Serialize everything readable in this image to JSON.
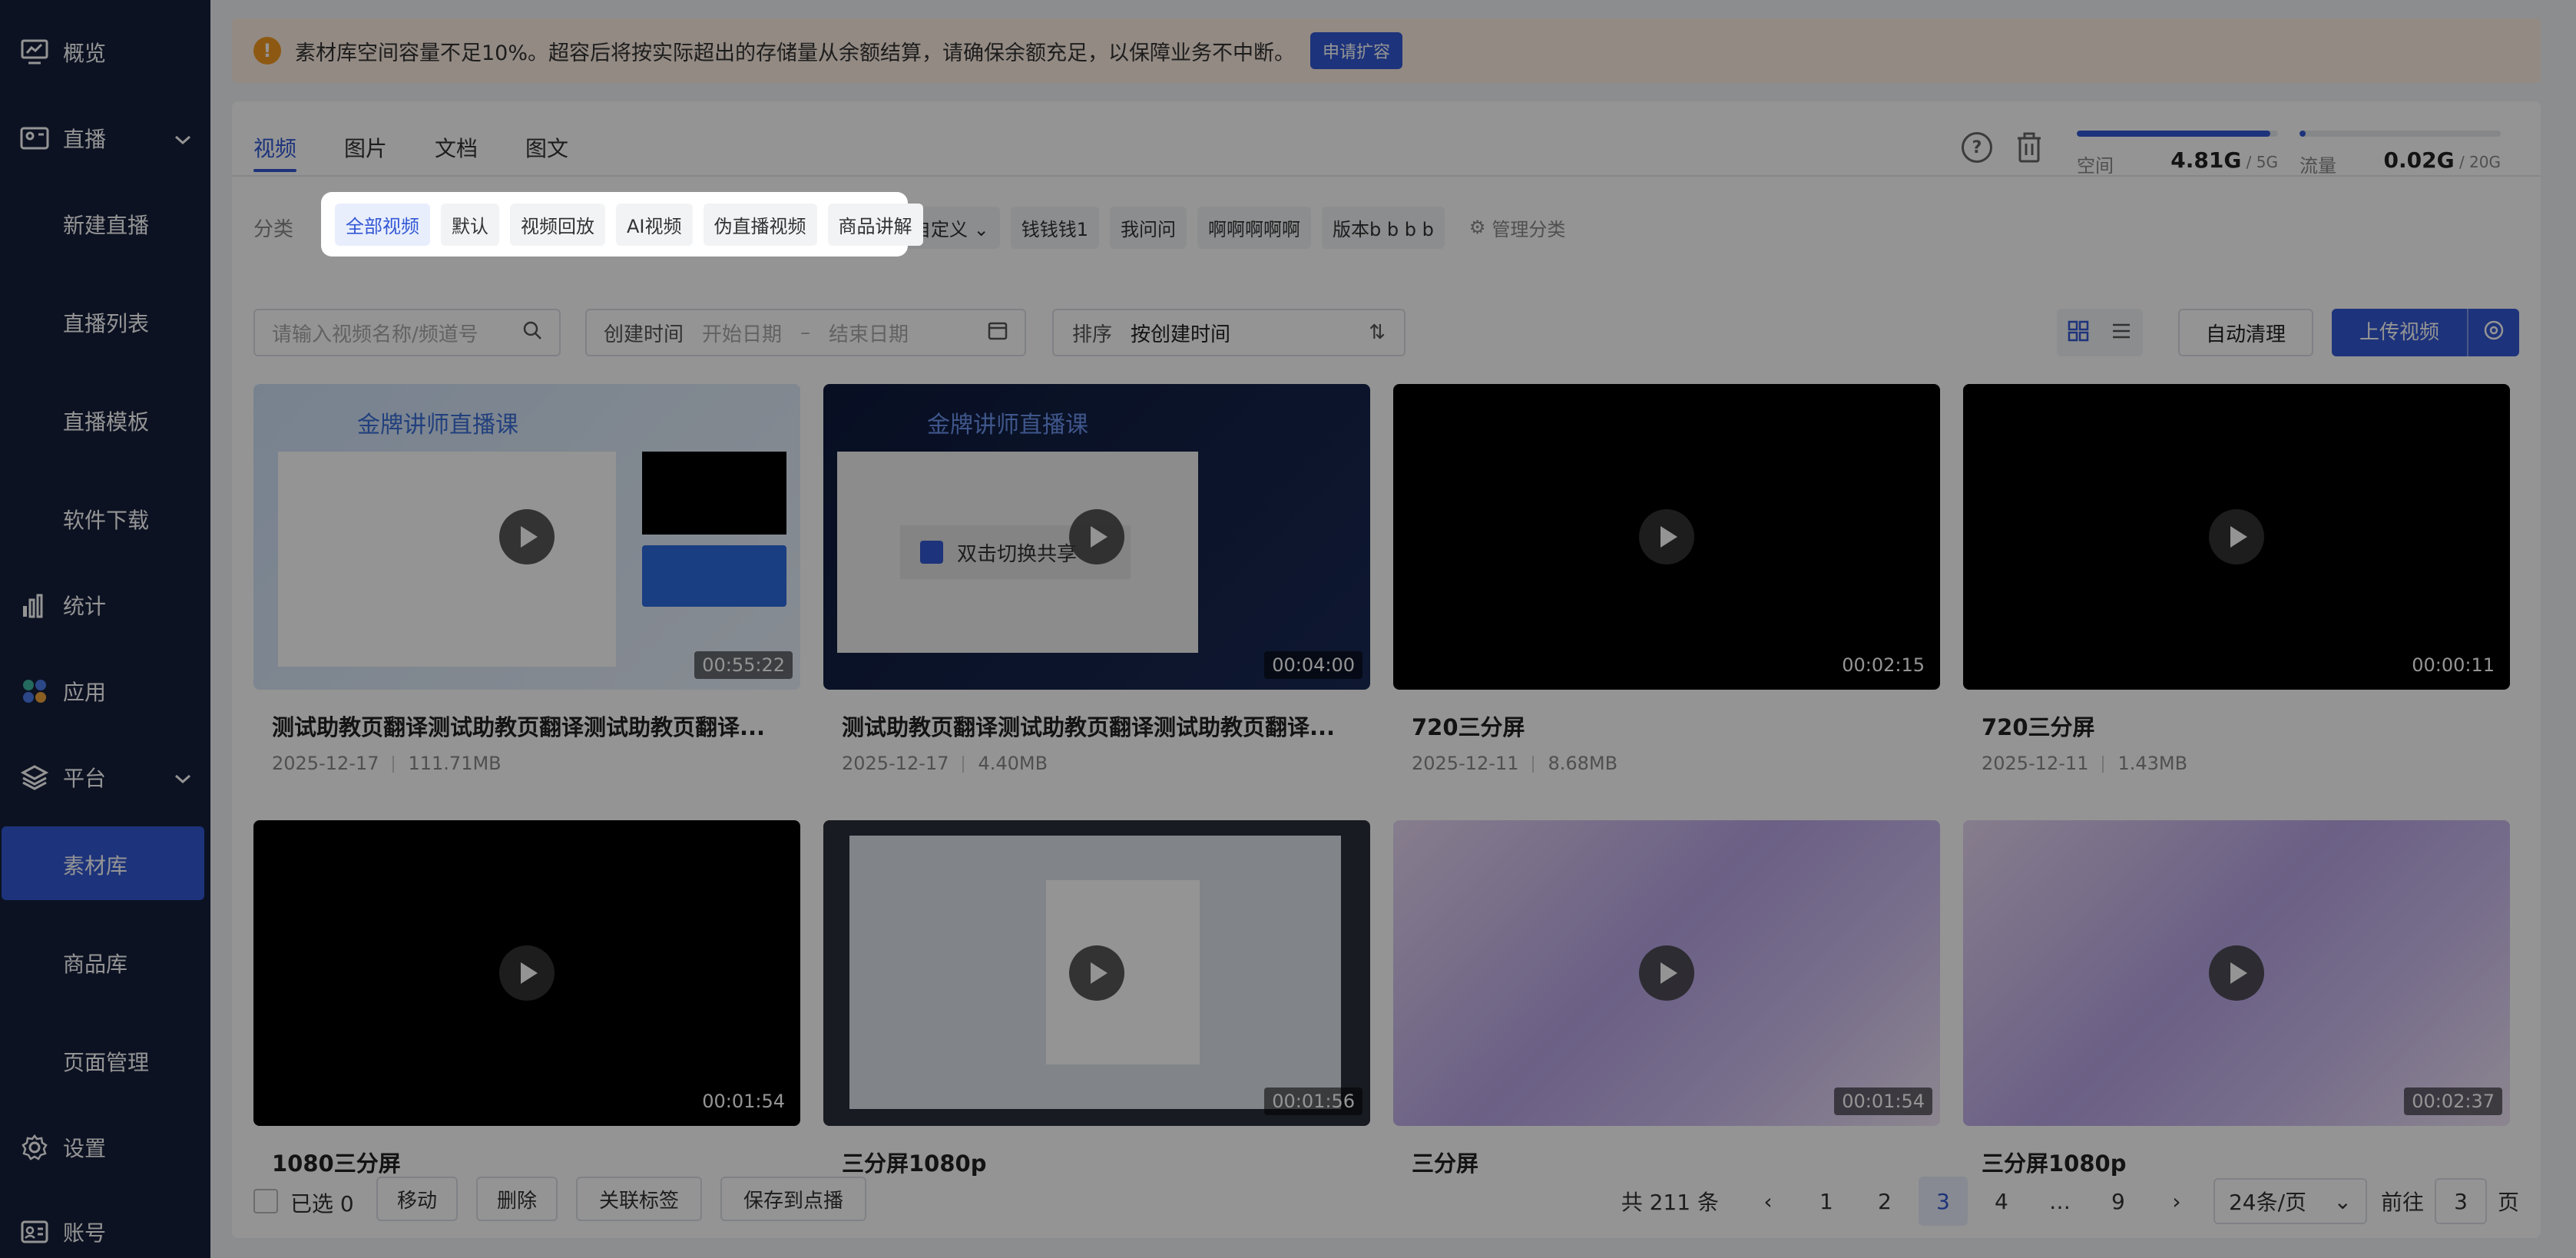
{
  "sidebar": {
    "items": [
      {
        "label": "概览",
        "icon": "dashboard-icon"
      },
      {
        "label": "直播",
        "icon": "live-icon"
      },
      {
        "label": "新建直播"
      },
      {
        "label": "直播列表"
      },
      {
        "label": "直播模板"
      },
      {
        "label": "软件下载"
      },
      {
        "label": "统计",
        "icon": "stats-icon"
      },
      {
        "label": "应用",
        "icon": "apps-icon"
      },
      {
        "label": "平台",
        "icon": "platform-icon"
      },
      {
        "label": "素材库"
      },
      {
        "label": "商品库"
      },
      {
        "label": "页面管理"
      },
      {
        "label": "设置",
        "icon": "settings-icon"
      },
      {
        "label": "账号",
        "icon": "account-icon"
      }
    ]
  },
  "banner": {
    "text": "素材库空间容量不足10%。超容后将按实际超出的存储量从余额结算，请确保余额充足，以保障业务不中断。",
    "button": "申请扩容"
  },
  "tabs": [
    "视频",
    "图片",
    "文档",
    "图文"
  ],
  "storage": {
    "space_label": "空间",
    "space_used": "4.81G",
    "space_cap": " / 5G",
    "space_fraction": 0.962,
    "traffic_label": "流量",
    "traffic_used": "0.02G",
    "traffic_cap": " / 20G",
    "traffic_fraction": 0.01
  },
  "categories": {
    "label": "分类",
    "highlighted": [
      "全部视频",
      "默认",
      "视频回放",
      "AI视频",
      "伪直播视频",
      "商品讲解"
    ],
    "others": [
      "钱钱钱1",
      "我问问",
      "啊啊啊啊啊",
      "版本b b b b"
    ],
    "custom": "自定义",
    "manage": "管理分类"
  },
  "filters": {
    "search_placeholder": "请输入视频名称/频道号",
    "date_label": "创建时间",
    "start_placeholder": "开始日期",
    "dash": "–",
    "end_placeholder": "结束日期",
    "sort_label": "排序",
    "sort_value": "按创建时间",
    "auto_clean": "自动清理",
    "upload": "上传视频"
  },
  "videos": [
    {
      "title": "测试助教页翻译测试助教页翻译测试助教页翻译...",
      "date": "2025-12-17",
      "size": "111.71MB",
      "duration": "00:55:22",
      "slide_title": "金牌讲师直播课"
    },
    {
      "title": "测试助教页翻译测试助教页翻译测试助教页翻译...",
      "date": "2025-12-17",
      "size": "4.40MB",
      "duration": "00:04:00",
      "slide_title": "金牌讲师直播课",
      "overlay_text": "双击切换共享"
    },
    {
      "title": "720三分屏",
      "date": "2025-12-11",
      "size": "8.68MB",
      "duration": "00:02:15"
    },
    {
      "title": "720三分屏",
      "date": "2025-12-11",
      "size": "1.43MB",
      "duration": "00:00:11"
    },
    {
      "title": "1080三分屏",
      "duration": "00:01:54"
    },
    {
      "title": "三分屏1080p",
      "duration": "00:01:56"
    },
    {
      "title": "三分屏",
      "duration": "00:01:54"
    },
    {
      "title": "三分屏1080p",
      "duration": "00:02:37"
    }
  ],
  "footer": {
    "selected": "已选 0",
    "move": "移动",
    "delete": "删除",
    "link_tags": "关联标签",
    "save_vod": "保存到点播",
    "total": "共 211 条",
    "pages": [
      "1",
      "2",
      "3",
      "4",
      "…",
      "9"
    ],
    "page_size": "24条/页",
    "goto_label": "前往",
    "goto_value": "3",
    "page_suffix": "页"
  },
  "colors": {
    "accent": "#3358d4",
    "sidebar": "#16203c",
    "warning": "#f39a1f"
  }
}
